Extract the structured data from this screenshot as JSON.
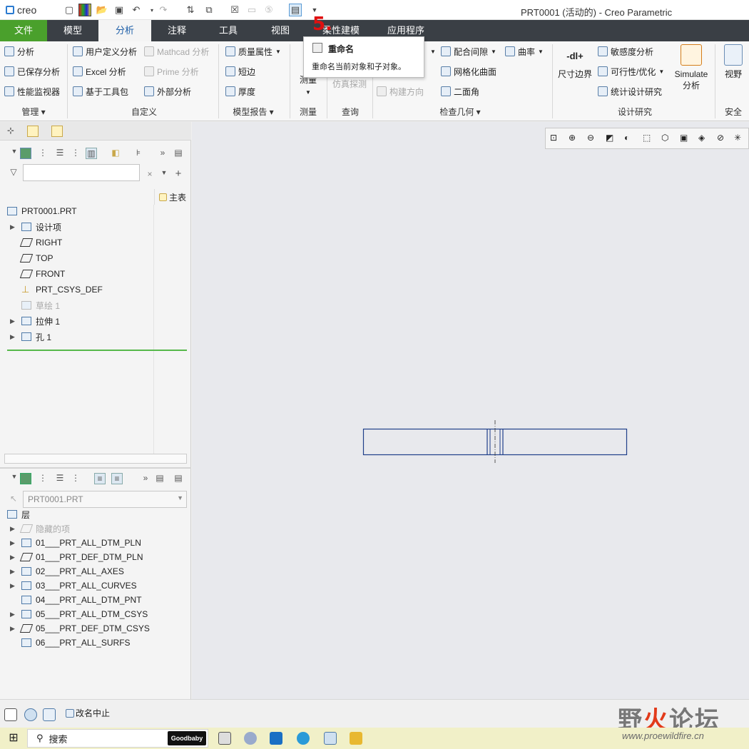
{
  "app": {
    "logo": "creo",
    "window_title": "PRT0001 (活动的) - Creo Parametric"
  },
  "tabs": [
    "文件",
    "模型",
    "分析",
    "注释",
    "工具",
    "视图",
    "柔性建模",
    "应用程序"
  ],
  "active_tab": "分析",
  "step_marker": "5.",
  "tooltip": {
    "title": "重命名",
    "description": "重命名当前对象和子对象。"
  },
  "ribbon": {
    "manage": {
      "label": "管理",
      "items": [
        "分析",
        "已保存分析",
        "性能监视器"
      ]
    },
    "custom": {
      "label": "自定义",
      "items": [
        "用户定义分析",
        "Excel 分析",
        "基于工具包",
        "Mathcad 分析",
        "Prime 分析",
        "外部分析"
      ]
    },
    "model_report": {
      "label": "模型报告",
      "items": [
        "质量属性",
        "短边",
        "厚度"
      ]
    },
    "measure": {
      "label": "测量",
      "button": "测量"
    },
    "query": {
      "label": "查询",
      "button": "仿真探测"
    },
    "inspect": {
      "label": "检查几何",
      "items": [
        "配合间隙",
        "网格化曲面",
        "二面角",
        "曲率",
        "构建方向"
      ]
    },
    "design_study": {
      "label": "设计研究",
      "items": [
        "敏感度分析",
        "可行性/优化",
        "统计设计研究"
      ],
      "big_buttons": [
        "尺寸边界",
        "Simulate 分析"
      ],
      "dim_icon_text": "-dl+"
    },
    "safety": {
      "label": "安全",
      "button": "视野"
    }
  },
  "model_tree": {
    "column_header": "主表",
    "filter_placeholder": "",
    "root": "PRT0001.PRT",
    "items": [
      {
        "label": "设计项",
        "expandable": true,
        "dim": false
      },
      {
        "label": "RIGHT",
        "expandable": false,
        "dim": false
      },
      {
        "label": "TOP",
        "expandable": false,
        "dim": false
      },
      {
        "label": "FRONT",
        "expandable": false,
        "dim": false
      },
      {
        "label": "PRT_CSYS_DEF",
        "expandable": false,
        "dim": false
      },
      {
        "label": "草绘 1",
        "expandable": false,
        "dim": true
      },
      {
        "label": "拉伸 1",
        "expandable": true,
        "dim": false
      },
      {
        "label": "孔 1",
        "expandable": true,
        "dim": false
      }
    ]
  },
  "layer_tree": {
    "model_select": "PRT0001.PRT",
    "root": "层",
    "items": [
      {
        "label": "隐藏的项",
        "dim": true
      },
      {
        "label": "01___PRT_ALL_DTM_PLN",
        "dim": false
      },
      {
        "label": "01___PRT_DEF_DTM_PLN",
        "dim": false
      },
      {
        "label": "02___PRT_ALL_AXES",
        "dim": false
      },
      {
        "label": "03___PRT_ALL_CURVES",
        "dim": false
      },
      {
        "label": "04___PRT_ALL_DTM_PNT",
        "dim": false
      },
      {
        "label": "05___PRT_ALL_DTM_CSYS",
        "dim": false
      },
      {
        "label": "05___PRT_DEF_DTM_CSYS",
        "dim": false
      },
      {
        "label": "06___PRT_ALL_SURFS",
        "dim": false
      }
    ]
  },
  "status": {
    "message": "改名中止"
  },
  "watermark": {
    "text_a": "野",
    "text_b": "火",
    "text_c": "论坛",
    "url": "www.proewildfire.cn"
  },
  "taskbar": {
    "search": "搜索",
    "goodbaby": "Goodbaby"
  },
  "colors": {
    "tabbar_bg": "#3a3f45",
    "file_tab": "#4aa02c",
    "active_tab_text": "#1e5fa8",
    "model_outline": "#1f3f8a",
    "step_red": "#e01010"
  }
}
